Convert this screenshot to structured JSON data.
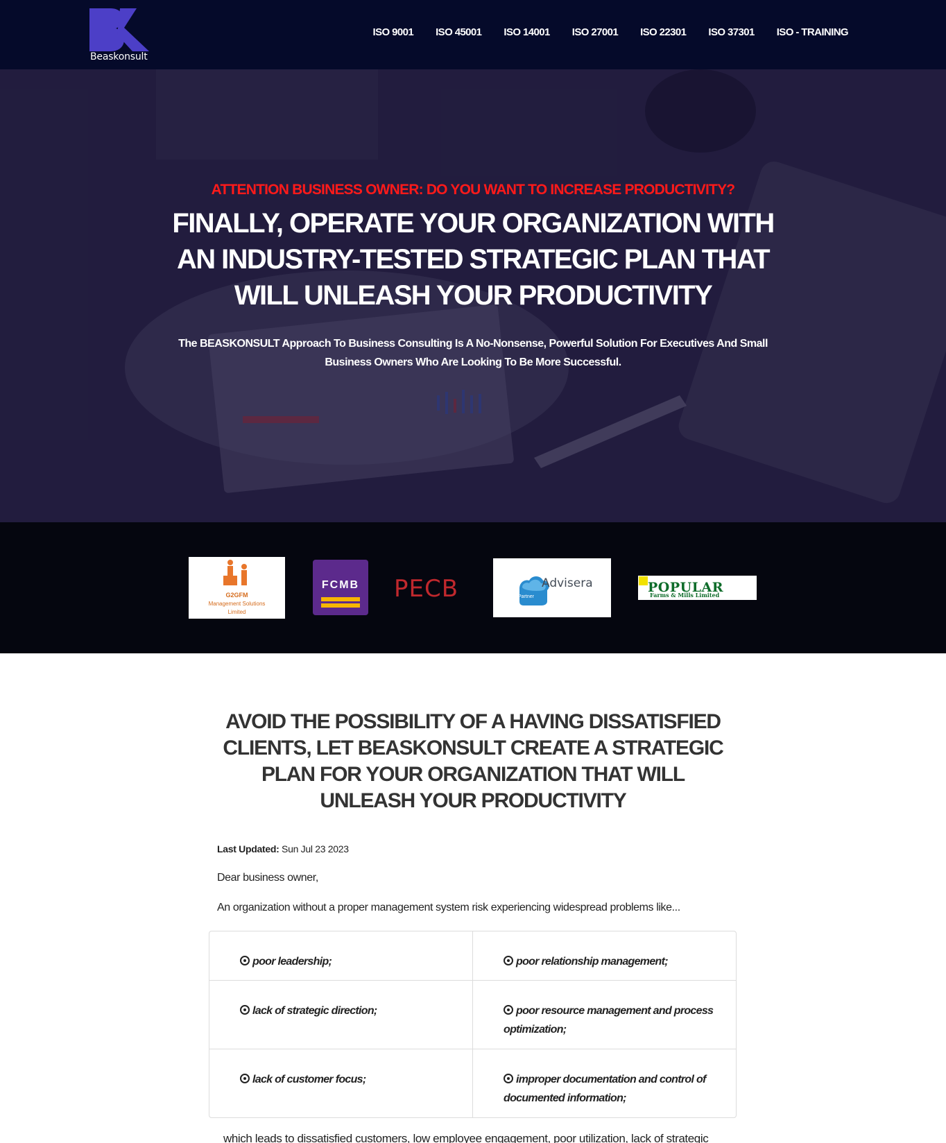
{
  "brand": {
    "name": "Beaskonsult",
    "mark_color": "#4c3fc7"
  },
  "nav": {
    "links": [
      {
        "label": "ISO 9001"
      },
      {
        "label": "ISO 45001"
      },
      {
        "label": "ISO 14001"
      },
      {
        "label": "ISO 27001"
      },
      {
        "label": "ISO 22301"
      },
      {
        "label": "ISO 37301"
      },
      {
        "label": "ISO - TRAINING"
      }
    ]
  },
  "hero": {
    "kicker": "ATTENTION BUSINESS OWNER: DO YOU WANT  TO INCREASE PRODUCTIVITY?",
    "title": "FINALLY, OPERATE YOUR ORGANIZATION WITH AN INDUSTRY-TESTED STRATEGIC PLAN THAT WILL UNLEASH YOUR PRODUCTIVITY",
    "subtitle": "The BEASKONSULT Approach To Business Consulting Is A No-Nonsense, Powerful Solution For Executives And Small Business Owners Who Are Looking To Be More Successful.",
    "kicker_color": "#ff1a1a"
  },
  "clients": {
    "g2gfm": {
      "line1": "G2GFM",
      "line2": "Management Solutions",
      "line3": "Limited"
    },
    "fcmb": {
      "label": "FCMB"
    },
    "pecb": {
      "label": "PECB"
    },
    "advisera": {
      "label": "Advisera",
      "badge": "Partner"
    },
    "popular": {
      "label": "POPULAR",
      "sub": "Farms & Mills Limited"
    }
  },
  "content": {
    "title": "AVOID THE POSSIBILITY OF A HAVING DISSATISFIED CLIENTS, LET BEASKONSULT CREATE A STRATEGIC PLAN FOR YOUR ORGANIZATION THAT WILL UNLEASH YOUR PRODUCTIVITY",
    "updated_label": "Last Updated:",
    "updated_value": "Sun Jul 23 2023",
    "greeting": "Dear business owner,",
    "intro": "An organization without a proper management system risk experiencing widespread problems like...",
    "problems": [
      "poor leadership;",
      "poor relationship management;",
      "lack of strategic direction;",
      "poor resource management and process optimization;",
      "lack of customer focus;",
      "improper documentation and control of documented information;"
    ],
    "trailing_text": "which leads to dissatisfied customers, low employee engagement, poor utilization, lack of strategic"
  }
}
